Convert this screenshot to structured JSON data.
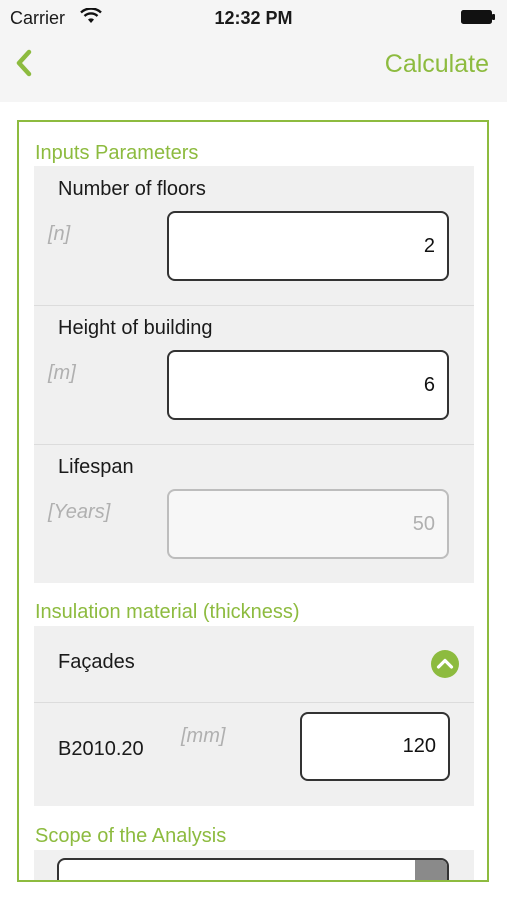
{
  "status_bar": {
    "carrier": "Carrier",
    "time": "12:32 PM"
  },
  "nav": {
    "back_icon": "chevron-left-icon",
    "calculate_label": "Calculate"
  },
  "colors": {
    "accent": "#8dbb3f",
    "panel_bg": "#f0f0f0"
  },
  "inputs_section": {
    "title": "Inputs Parameters",
    "fields": [
      {
        "label": "Number of floors",
        "unit": "[n]",
        "value": "2",
        "enabled": true
      },
      {
        "label": "Height of building",
        "unit": "[m]",
        "value": "6",
        "enabled": true
      },
      {
        "label": "Lifespan",
        "unit": "[Years]",
        "value": "50",
        "enabled": false
      }
    ]
  },
  "insulation_section": {
    "title": "Insulation material (thickness)",
    "group_label": "Façades",
    "toggle_icon": "chevron-up-circle-icon",
    "items": [
      {
        "code": "B2010.20",
        "unit": "[mm]",
        "value": "120"
      }
    ]
  },
  "scope_section": {
    "title": "Scope of the Analysis"
  }
}
